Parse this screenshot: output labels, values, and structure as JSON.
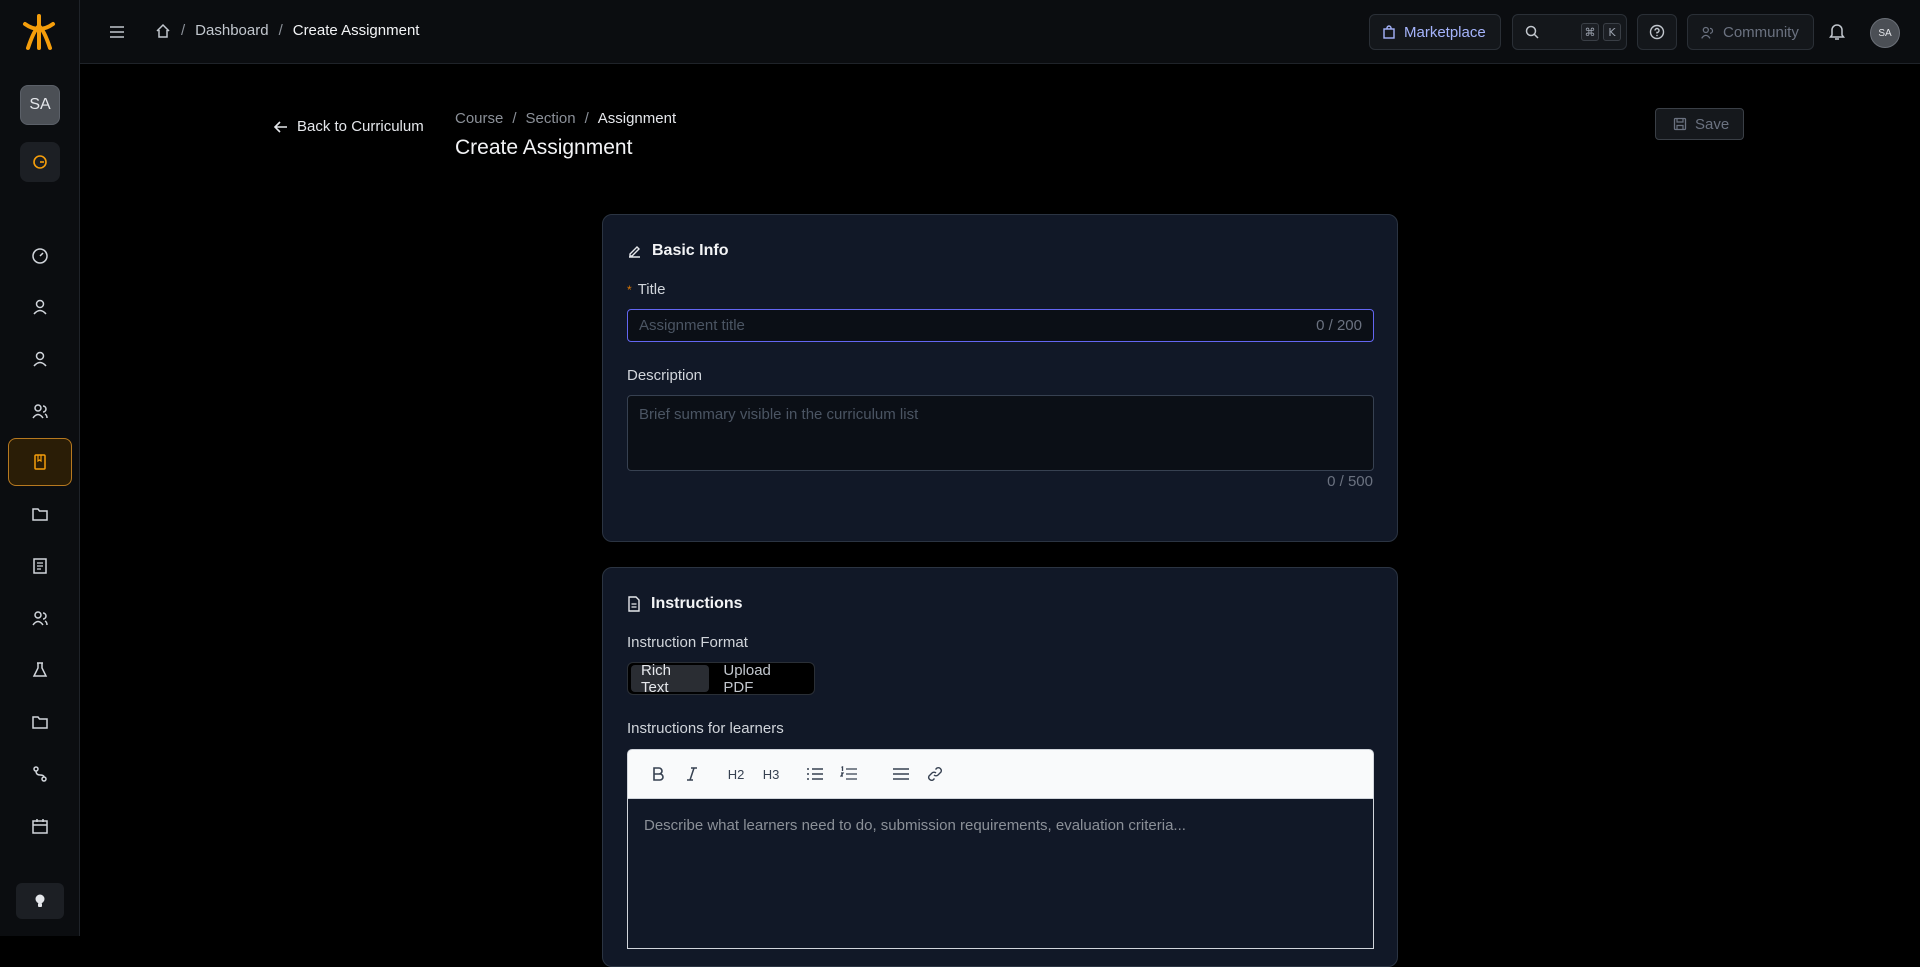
{
  "sidebar": {
    "user_initials": "SA",
    "nav_items": [
      {
        "name": "dashboard",
        "icon": "gauge-icon",
        "active": false
      },
      {
        "name": "users",
        "icon": "user-icon",
        "active": false
      },
      {
        "name": "instructors",
        "icon": "user-icon",
        "active": false
      },
      {
        "name": "groups",
        "icon": "users-icon",
        "active": false
      },
      {
        "name": "courses",
        "icon": "book-icon",
        "active": true
      },
      {
        "name": "files",
        "icon": "folder-icon",
        "active": false
      },
      {
        "name": "reports",
        "icon": "receipt-icon",
        "active": false
      },
      {
        "name": "teams",
        "icon": "users-icon",
        "active": false
      },
      {
        "name": "labs",
        "icon": "flask-icon",
        "active": false
      },
      {
        "name": "library",
        "icon": "folder-icon",
        "active": false
      },
      {
        "name": "paths",
        "icon": "route-icon",
        "active": false
      },
      {
        "name": "calendar",
        "icon": "calendar-icon",
        "active": false
      }
    ]
  },
  "header": {
    "breadcrumb": [
      "Dashboard",
      "Create Assignment"
    ],
    "marketplace_label": "Marketplace",
    "shortcut_keys": [
      "⌘",
      "K"
    ],
    "community_label": "Community",
    "user_initials": "SA"
  },
  "page": {
    "back_label": "Back to Curriculum",
    "breadcrumb": [
      "Course",
      "Section",
      "Assignment"
    ],
    "title": "Create Assignment",
    "save_label": "Save"
  },
  "basic_info": {
    "heading": "Basic Info",
    "title_label": "Title",
    "title_placeholder": "Assignment title",
    "title_counter": "0 / 200",
    "description_label": "Description",
    "description_placeholder": "Brief summary visible in the curriculum list",
    "description_counter": "0 / 500"
  },
  "instructions": {
    "heading": "Instructions",
    "format_label": "Instruction Format",
    "format_options": [
      "Rich Text",
      "Upload PDF"
    ],
    "selected_format": "Rich Text",
    "editor_label": "Instructions for learners",
    "toolbar": {
      "h2": "H2",
      "h3": "H3"
    },
    "editor_placeholder": "Describe what learners need to do, submission requirements, evaluation criteria..."
  },
  "colors": {
    "accent": "#f59e0b",
    "focus": "#6366f1",
    "card_bg": "#111827"
  }
}
